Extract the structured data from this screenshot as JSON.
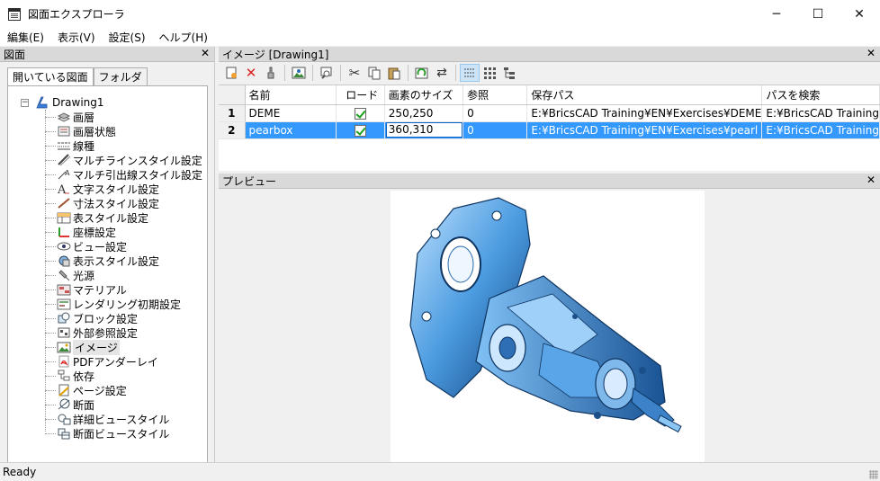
{
  "window": {
    "title": "図面エクスプローラ",
    "minimize": "─",
    "maximize": "☐",
    "close": "✕"
  },
  "menu": [
    "編集(E)",
    "表示(V)",
    "設定(S)",
    "ヘルプ(H)"
  ],
  "left_panel": {
    "title": "図面",
    "close": "✕",
    "tabs": [
      "開いている図面",
      "フォルダ"
    ],
    "root": {
      "label": "Drawing1",
      "expander": "−",
      "icon": "drawing-icon"
    },
    "items": [
      {
        "label": "画層",
        "icon": "layers-icon"
      },
      {
        "label": "画層状態",
        "icon": "layer-states-icon"
      },
      {
        "label": "線種",
        "icon": "linetype-icon"
      },
      {
        "label": "マルチラインスタイル設定",
        "icon": "multiline-style-icon"
      },
      {
        "label": "マルチ引出線スタイル設定",
        "icon": "multileader-style-icon"
      },
      {
        "label": "文字スタイル設定",
        "icon": "text-style-icon"
      },
      {
        "label": "寸法スタイル設定",
        "icon": "dimension-style-icon"
      },
      {
        "label": "表スタイル設定",
        "icon": "table-style-icon"
      },
      {
        "label": "座標設定",
        "icon": "ucs-icon"
      },
      {
        "label": "ビュー設定",
        "icon": "view-icon"
      },
      {
        "label": "表示スタイル設定",
        "icon": "visual-style-icon"
      },
      {
        "label": "光源",
        "icon": "light-icon"
      },
      {
        "label": "マテリアル",
        "icon": "material-icon"
      },
      {
        "label": "レンダリング初期設定",
        "icon": "render-preset-icon"
      },
      {
        "label": "ブロック設定",
        "icon": "block-icon"
      },
      {
        "label": "外部参照設定",
        "icon": "xref-icon"
      },
      {
        "label": "イメージ",
        "icon": "image-icon",
        "selected": true
      },
      {
        "label": "PDFアンダーレイ",
        "icon": "pdf-icon"
      },
      {
        "label": "依存",
        "icon": "dependency-icon"
      },
      {
        "label": "ページ設定",
        "icon": "page-setup-icon"
      },
      {
        "label": "断面",
        "icon": "section-icon"
      },
      {
        "label": "詳細ビュースタイル",
        "icon": "detail-view-style-icon"
      },
      {
        "label": "断面ビュースタイル",
        "icon": "section-view-style-icon"
      }
    ]
  },
  "images_panel": {
    "title": "イメージ [Drawing1]",
    "close": "✕",
    "toolbar": [
      {
        "icon": "new-icon"
      },
      {
        "icon": "delete-icon"
      },
      {
        "icon": "purge-icon"
      },
      {
        "sep": true
      },
      {
        "icon": "insert-image-icon"
      },
      {
        "sep": true
      },
      {
        "icon": "find-icon"
      },
      {
        "sep": true
      },
      {
        "icon": "cut-icon"
      },
      {
        "icon": "copy-icon"
      },
      {
        "icon": "paste-icon"
      },
      {
        "sep": true
      },
      {
        "icon": "reload-icon"
      },
      {
        "icon": "swap-icon"
      },
      {
        "sep": true
      },
      {
        "icon": "details-view-icon",
        "active": true
      },
      {
        "icon": "icons-view-icon"
      },
      {
        "icon": "tree-view-icon"
      }
    ],
    "columns": [
      "名前",
      "ロード",
      "画素のサイズ",
      "参照",
      "保存パス",
      "パスを検索"
    ],
    "rows": [
      {
        "num": "1",
        "name": "DEME",
        "loaded": true,
        "size": "250,250",
        "refs": "0",
        "saved_path": "E:¥BricsCAD Training¥EN¥Exercises¥DEME",
        "found_path": "E:¥BricsCAD Training"
      },
      {
        "num": "2",
        "name": "pearbox",
        "loaded": true,
        "size": "360,310",
        "refs": "0",
        "saved_path": "E:¥BricsCAD Training¥EN¥Exercises¥pearl",
        "found_path": "E:¥BricsCAD Training"
      }
    ],
    "selected_row": 2
  },
  "preview_panel": {
    "title": "プレビュー",
    "close": "✕"
  },
  "status": {
    "text": "Ready"
  }
}
